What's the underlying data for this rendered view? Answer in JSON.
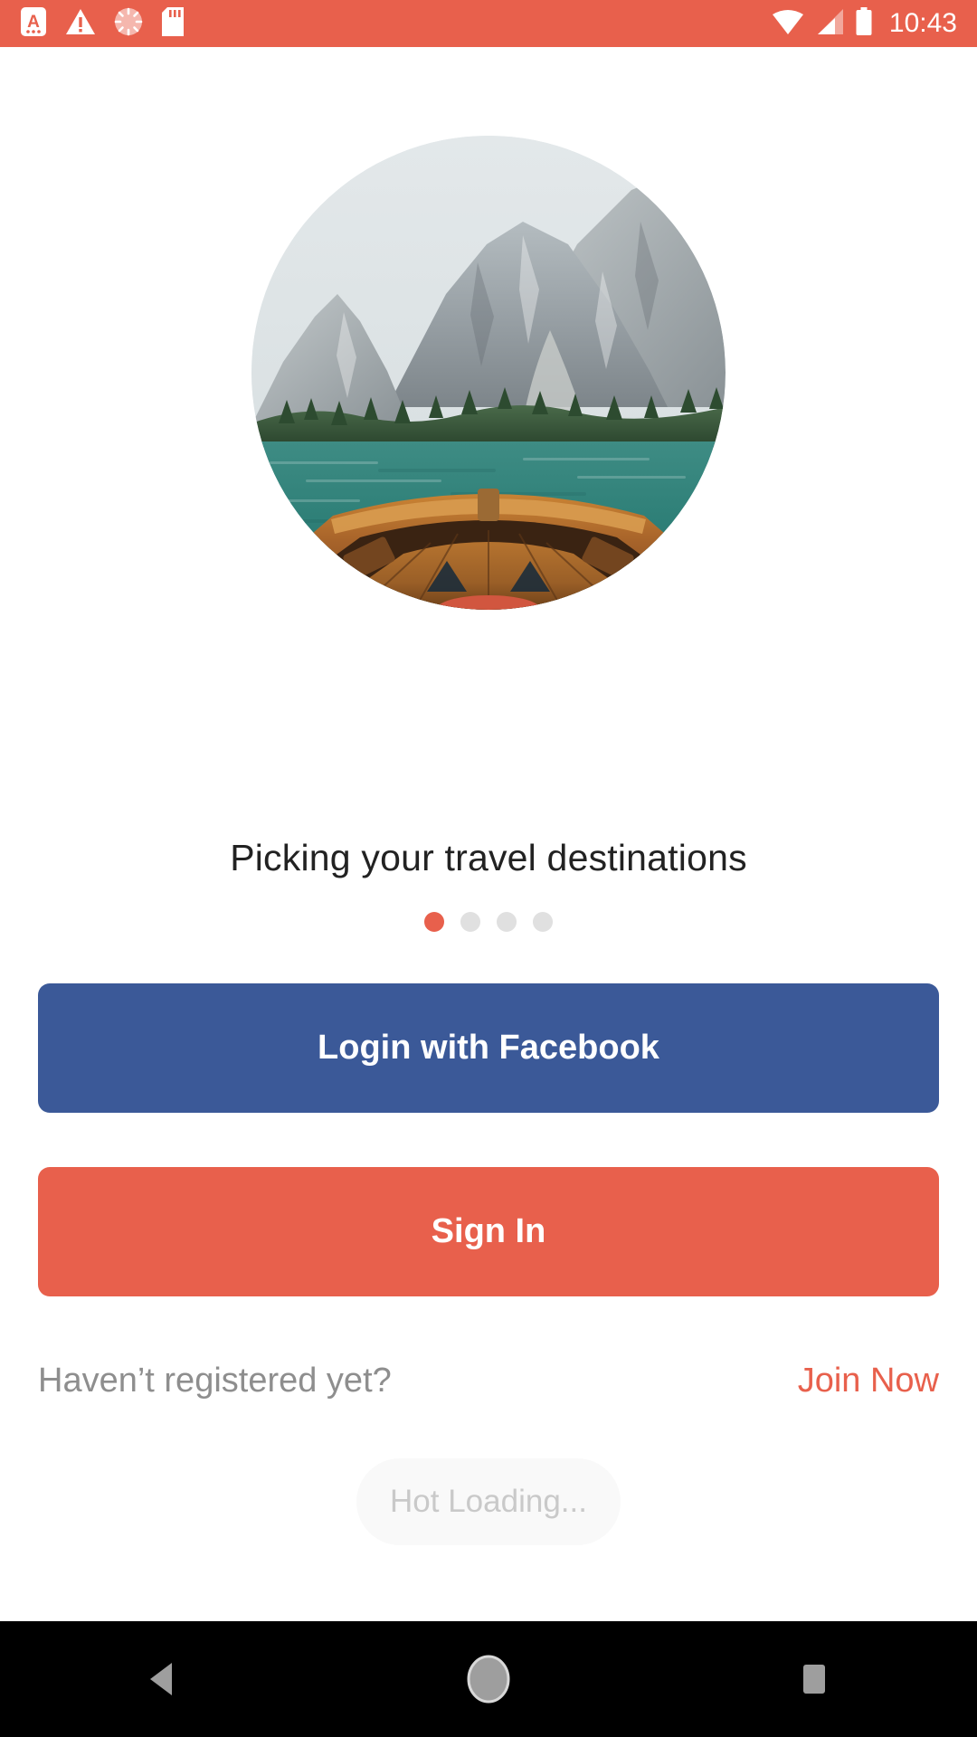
{
  "status_bar": {
    "background_color": "#E8604C",
    "time": "10:43",
    "left_icons": [
      {
        "name": "screenshot-capture-icon",
        "label": "A"
      },
      {
        "name": "warning-triangle-icon",
        "label": "!"
      },
      {
        "name": "sync-spinner-icon",
        "label": ""
      },
      {
        "name": "sd-card-icon",
        "label": ""
      }
    ],
    "right_icons": [
      {
        "name": "wifi-icon",
        "label": ""
      },
      {
        "name": "cellular-signal-icon",
        "label": ""
      },
      {
        "name": "battery-icon",
        "label": ""
      }
    ]
  },
  "onboarding": {
    "hero_image_alt": "Wooden rowboat bow on a turquoise alpine lake surrounded by pine forests and grey rocky mountains",
    "headline": "Picking your travel destinations",
    "pagination": {
      "total": 4,
      "active_index": 0,
      "active_color": "#E8604C",
      "inactive_color": "#E0E0E0"
    }
  },
  "actions": {
    "facebook_login_label": "Login with Facebook",
    "facebook_color": "#3B5998",
    "sign_in_label": "Sign In",
    "sign_in_color": "#E8604C"
  },
  "register": {
    "prompt": "Haven’t registered yet?",
    "link_label": "Join Now",
    "link_color": "#E8604C",
    "prompt_color": "#8E8E8E"
  },
  "toast": {
    "message": "Hot Loading..."
  },
  "navigation_bar": {
    "back_label": "Back",
    "home_label": "Home",
    "recents_label": "Recents"
  }
}
